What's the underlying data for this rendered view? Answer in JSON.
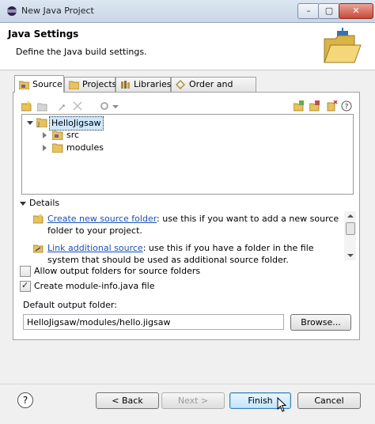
{
  "window": {
    "title": "New Java Project",
    "controls": {
      "minimize": "–",
      "maximize": "▢",
      "close": "✕"
    }
  },
  "header": {
    "title": "Java Settings",
    "description": "Define the Java build settings."
  },
  "tabs": [
    {
      "label": "Source",
      "icon": "source-folder-icon",
      "active": true
    },
    {
      "label": "Projects",
      "icon": "projects-icon",
      "active": false
    },
    {
      "label": "Libraries",
      "icon": "libraries-icon",
      "active": false
    },
    {
      "label": "Order and Export",
      "icon": "order-export-icon",
      "active": false
    }
  ],
  "tree": {
    "root": "HelloJigsaw",
    "children": [
      "src",
      "modules"
    ]
  },
  "details": {
    "label": "Details",
    "hint1_link": "Create new source folder",
    "hint1_text": ": use this if you want to add a new source folder to your project.",
    "hint2_link": "Link additional source",
    "hint2_text": ": use this if you have a folder in the file system that should be used as additional source folder."
  },
  "options": {
    "allow_output_folders": {
      "label": "Allow output folders for source folders",
      "checked": false
    },
    "create_module_info": {
      "label": "Create module-info.java file",
      "checked": true
    }
  },
  "output": {
    "label": "Default output folder:",
    "value": "HelloJigsaw/modules/hello.jigsaw",
    "browse_label": "Browse..."
  },
  "footer": {
    "help": "?",
    "back_label": "< Back",
    "next_label": "Next >",
    "finish_label": "Finish",
    "cancel_label": "Cancel"
  },
  "colors": {
    "link": "#1a4fb5",
    "folder_yellow": "#e8c25a",
    "selection": "#cde8ff"
  }
}
